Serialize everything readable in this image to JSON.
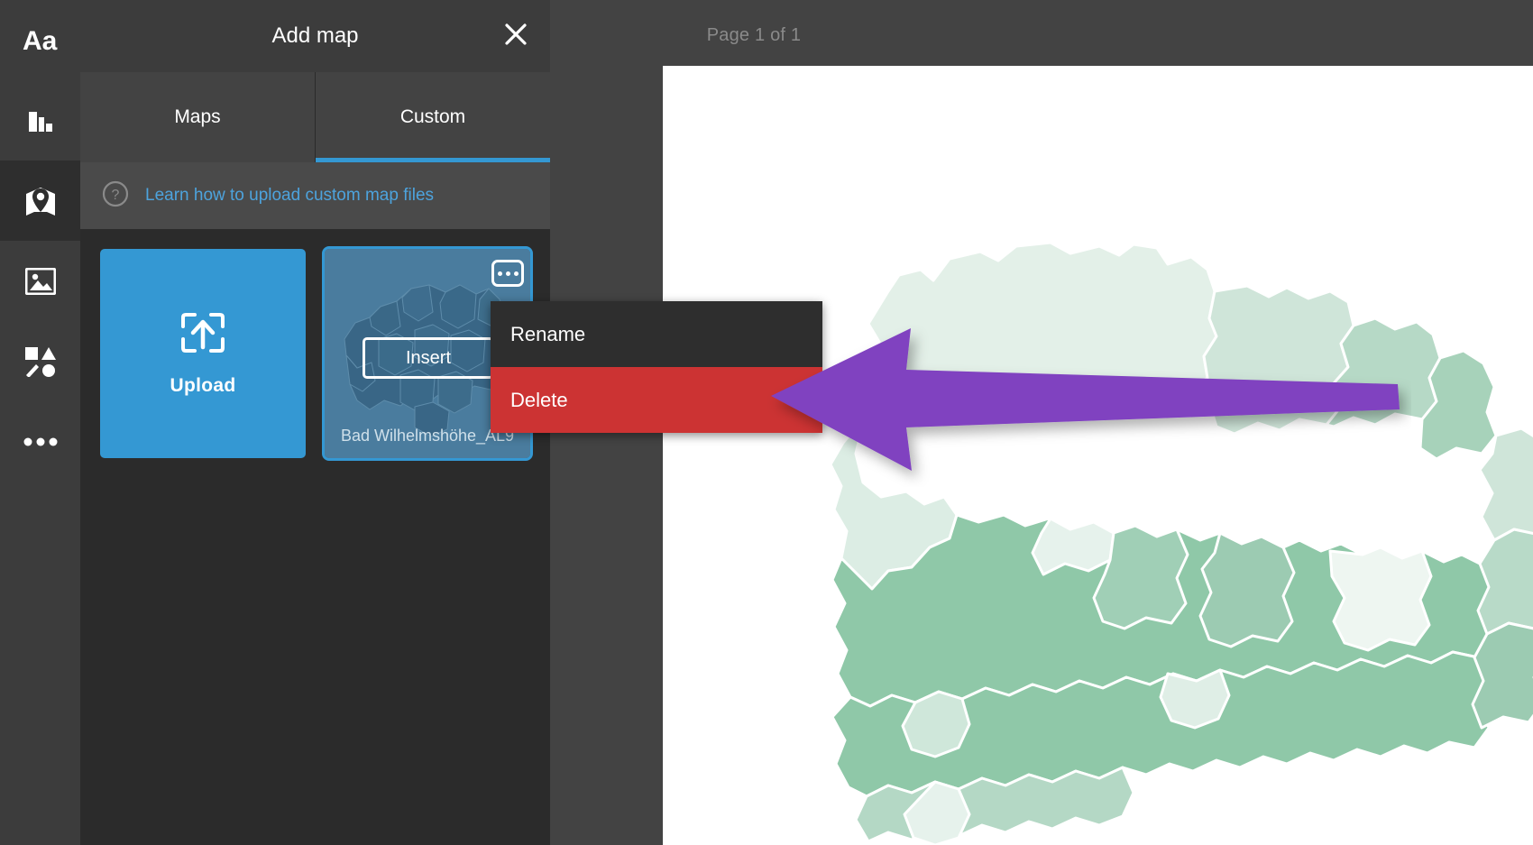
{
  "rail": {
    "items": [
      {
        "name": "text-tool",
        "icon": "text-icon",
        "active": false
      },
      {
        "name": "chart-tool",
        "icon": "chart-icon",
        "active": false
      },
      {
        "name": "map-tool",
        "icon": "map-pin-icon",
        "active": true
      },
      {
        "name": "image-tool",
        "icon": "image-icon",
        "active": false
      },
      {
        "name": "shapes-tool",
        "icon": "shapes-icon",
        "active": false
      },
      {
        "name": "more-tool",
        "icon": "ellipsis-icon",
        "active": false
      }
    ]
  },
  "panel": {
    "title": "Add map",
    "close_icon": "close-icon",
    "tabs": [
      {
        "label": "Maps",
        "active": false
      },
      {
        "label": "Custom",
        "active": true
      }
    ],
    "help": {
      "icon": "help-circle-icon",
      "text": "Learn how to upload custom map files",
      "color": "#4da3dd"
    },
    "cards": {
      "upload": {
        "label": "Upload",
        "icon": "upload-icon",
        "color": "#3498d3"
      },
      "custom_map": {
        "name": "Bad Wilhelmshöhe_AL9",
        "insert_label": "Insert",
        "menu_icon": "ellipsis-icon",
        "selected": true,
        "border_color": "#3498d3"
      }
    }
  },
  "context_menu": {
    "items": [
      {
        "label": "Rename",
        "style": "default",
        "color": "#2e2e2e"
      },
      {
        "label": "Delete",
        "style": "danger",
        "color": "#cc3333"
      }
    ]
  },
  "annotation": {
    "type": "arrow",
    "color": "#8042c0",
    "points_to": "Delete"
  },
  "canvas": {
    "page_label": "Page 1 of 1",
    "background": "#434343",
    "sheet_color": "#ffffff"
  },
  "chart_data": {
    "type": "map",
    "title": "",
    "description": "Choropleth map of districts rendered on the document page",
    "palette": [
      "#e8f3ec",
      "#d9ece0",
      "#c4e0d0",
      "#aed5be",
      "#94c9ac",
      "#7cbd9c"
    ],
    "legend": null
  }
}
